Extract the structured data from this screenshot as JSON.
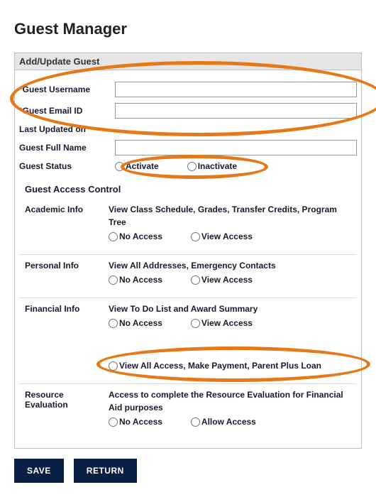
{
  "title": "Guest Manager",
  "panel_header": "Add/Update Guest",
  "fields": {
    "username_label": "Guest Username",
    "email_label": "Guest Email ID",
    "last_updated_label": "Last Updated on",
    "fullname_label": "Guest Full Name",
    "status_label": "Guest Status",
    "required_mark": "*",
    "username_value": "",
    "email_value": "",
    "fullname_value": ""
  },
  "status_options": {
    "activate": "Activate",
    "inactivate": "Inactivate"
  },
  "access_control_header": "Guest Access Control",
  "sections": {
    "academic": {
      "label": "Academic Info",
      "desc": "View Class Schedule, Grades, Transfer Credits, Program Tree",
      "no_access": "No Access",
      "view_access": "View Access"
    },
    "personal": {
      "label": "Personal Info",
      "desc": "View All Addresses, Emergency Contacts",
      "no_access": "No Access",
      "view_access": "View Access"
    },
    "financial": {
      "label": "Financial Info",
      "desc": "View To Do List and Award Summary",
      "no_access": "No Access",
      "view_access": "View Access",
      "view_all": "View All Access, Make Payment, Parent Plus Loan"
    },
    "resource": {
      "label": "Resource Evaluation",
      "desc": "Access to complete the Resource Evaluation for Financial Aid purposes",
      "no_access": "No Access",
      "allow_access": "Allow Access"
    }
  },
  "buttons": {
    "save": "SAVE",
    "return": "RETURN"
  },
  "annotation_color": "#e67817"
}
